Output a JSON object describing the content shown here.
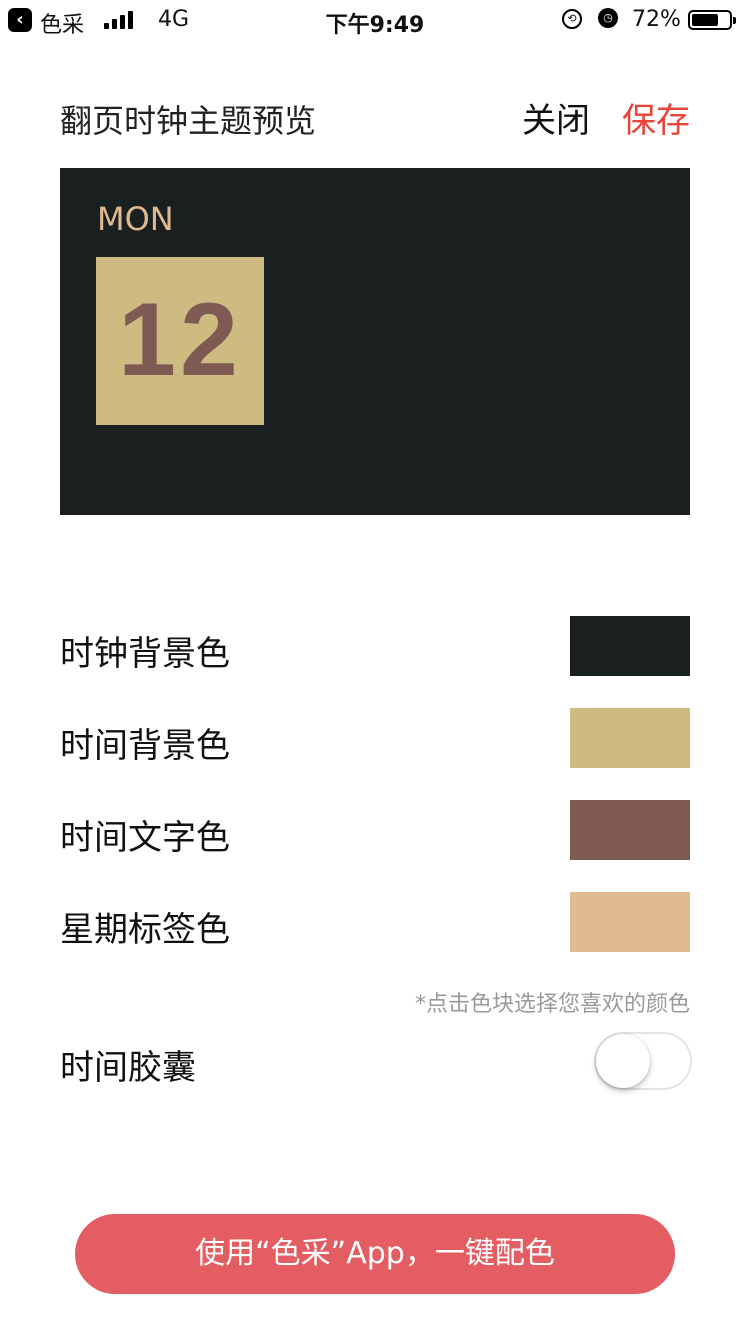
{
  "status_bar": {
    "back_app": "色采",
    "network": "4G",
    "time": "下午9:49",
    "battery_pct": "72%",
    "battery_level": 0.72,
    "back_icon": "chevron-left-icon",
    "icons": [
      "signal-icon",
      "rotation-lock-icon",
      "alarm-icon",
      "battery-icon"
    ]
  },
  "header": {
    "title": "翻页时钟主题预览",
    "close_label": "关闭",
    "save_label": "保存",
    "save_color": "#e8443a"
  },
  "preview": {
    "weekday": "MON",
    "digits": "12",
    "colors": {
      "clock_bg": "#1a1f20",
      "time_bg": "#cebb82",
      "time_text": "#7e5a52",
      "weekday_label": "#dfb990"
    }
  },
  "color_settings": [
    {
      "label": "时钟背景色",
      "color": "#1a1f20"
    },
    {
      "label": "时间背景色",
      "color": "#cebb82"
    },
    {
      "label": "时间文字色",
      "color": "#7e5a52"
    },
    {
      "label": "星期标签色",
      "color": "#dfb990"
    }
  ],
  "hint": "*点击色块选择您喜欢的颜色",
  "capsule": {
    "label": "时间胶囊",
    "enabled": false
  },
  "cta": {
    "label": "使用“色采”App，一键配色",
    "color": "#e35d63"
  }
}
